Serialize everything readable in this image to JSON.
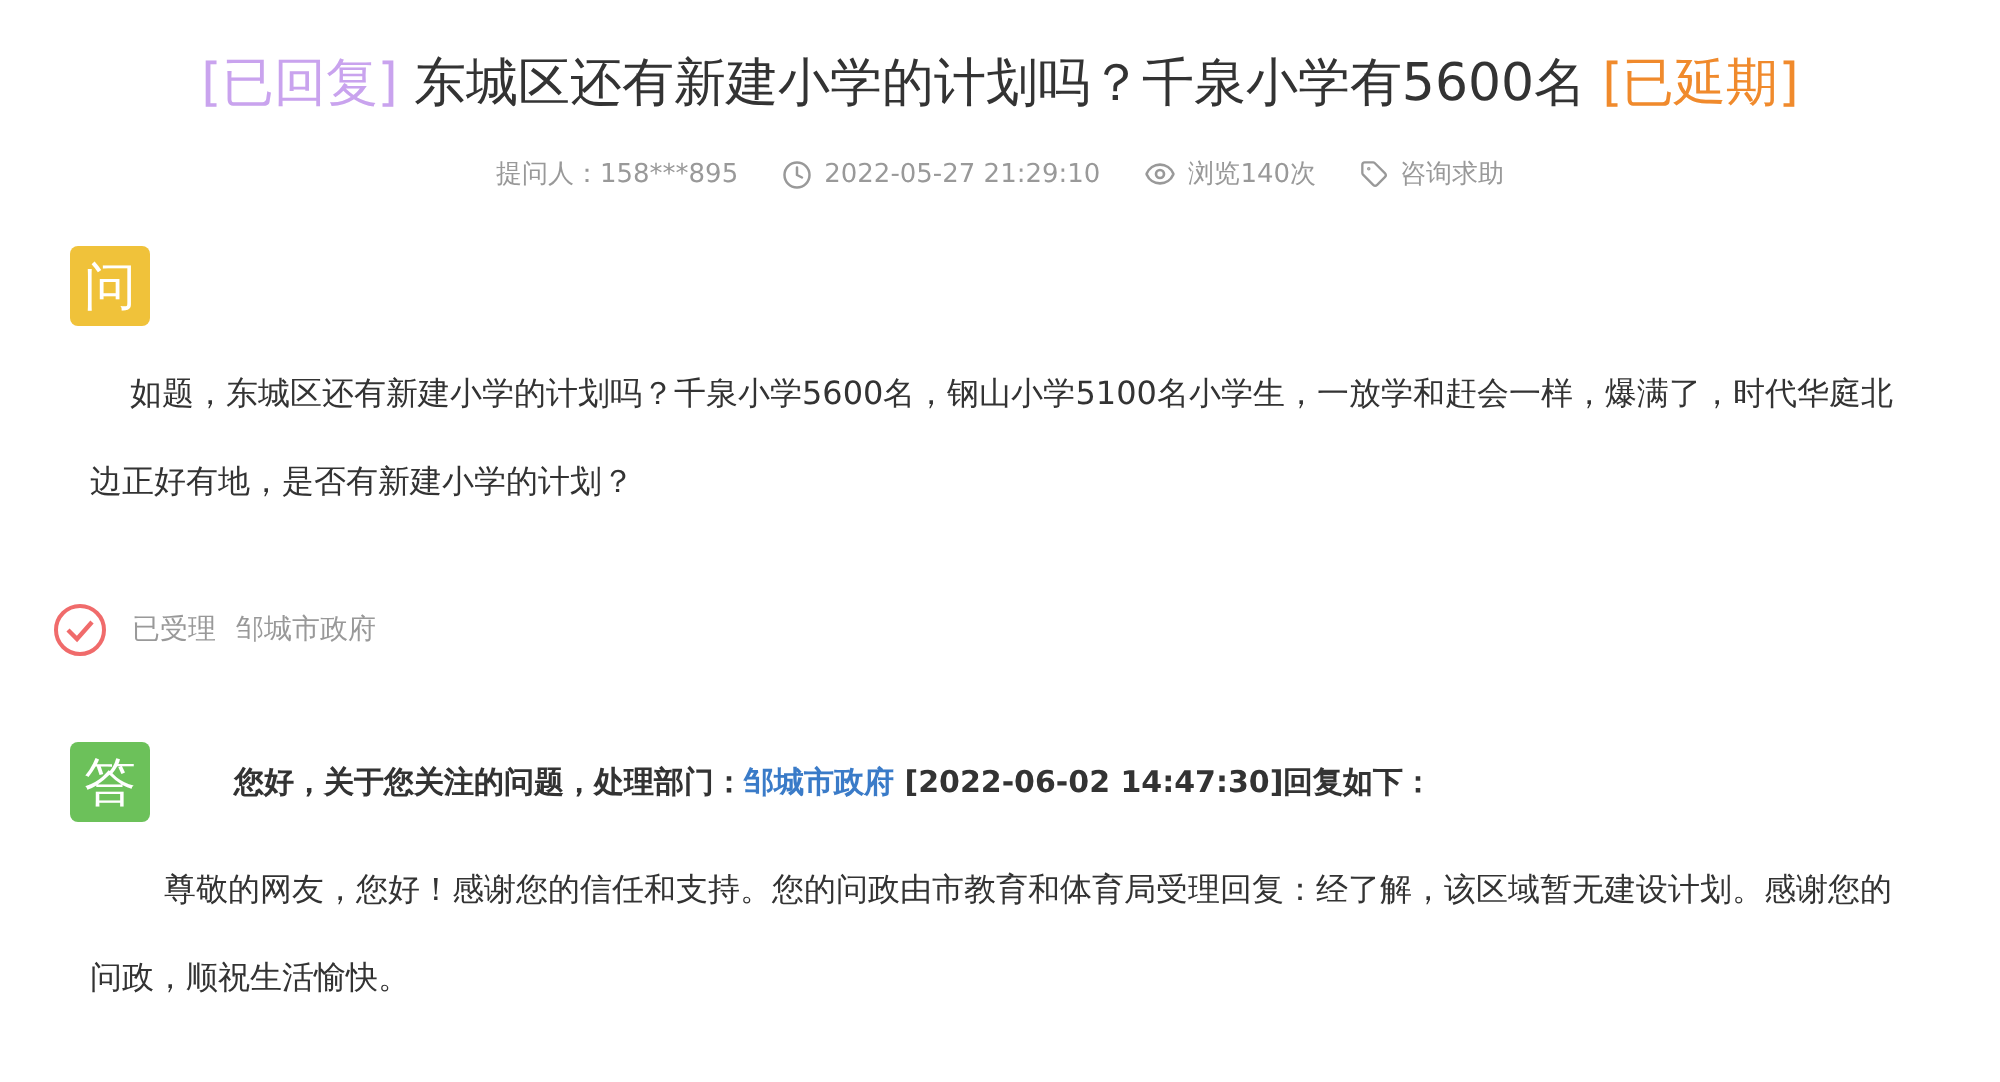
{
  "title": {
    "tags": [
      {
        "text": "[已回复]",
        "color": "#c9a3ee"
      },
      {
        "text": "[已延期]",
        "color": "#f08a2c"
      }
    ],
    "text": "东城区还有新建小学的计划吗？千泉小学有5600名"
  },
  "meta": [
    {
      "kind": "asker",
      "text": "提问人：158***895"
    },
    {
      "kind": "time",
      "text": "2022-05-27 21:29:10"
    },
    {
      "kind": "views",
      "text": "浏览140次"
    },
    {
      "kind": "category",
      "text": "咨询求助"
    }
  ],
  "question": {
    "badge": "问",
    "text": "如题，东城区还有新建小学的计划吗？千泉小学5600名，钢山小学5100名小学生，一放学和赶会一样，爆满了，时代华庭北边正好有地，是否有新建小学的计划？"
  },
  "status": {
    "accepted": true,
    "label": "已受理",
    "department": "邹城市政府"
  },
  "answer": {
    "badge": "答",
    "header_prefix": "您好，关于您关注的问题，处理部门：",
    "header_link": "邹城市政府",
    "header_suffix": " [2022-06-02 14:47:30]回复如下：",
    "text": "尊敬的网友，您好！感谢您的信任和支持。您的问政由市教育和体育局受理回复：经了解，该区域暂无建设计划。感谢您的问政，顺祝生活愉快。"
  }
}
